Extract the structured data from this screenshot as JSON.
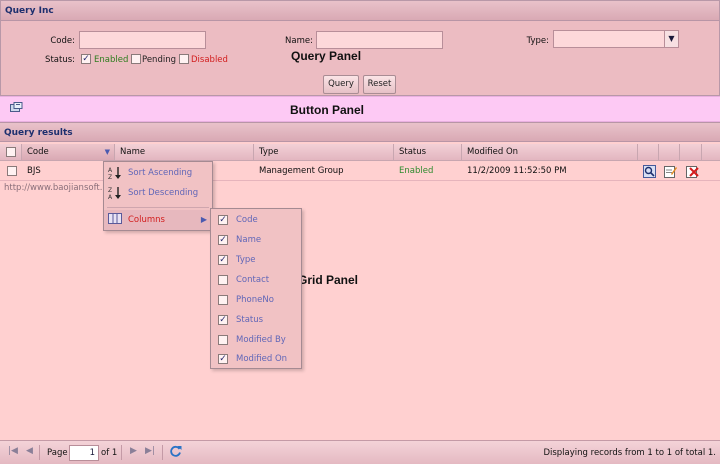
{
  "query_panel": {
    "title": "Query Inc",
    "code_label": "Code:",
    "code_value": "",
    "name_label": "Name:",
    "name_value": "",
    "type_label": "Type:",
    "type_value": "",
    "status_label": "Status:",
    "status_options": [
      {
        "label": "Enabled",
        "checked": true,
        "color": "#2e7d1e"
      },
      {
        "label": "Pending",
        "checked": false,
        "color": "#222222"
      },
      {
        "label": "Disabled",
        "checked": false,
        "color": "#d21e1e"
      }
    ],
    "query_button": "Query",
    "reset_button": "Reset",
    "annotation": "Query Panel"
  },
  "button_panel": {
    "annotation": "Button Panel"
  },
  "grid": {
    "title": "Query results",
    "columns": [
      "Code",
      "Name",
      "Type",
      "Status",
      "Modified On"
    ],
    "rows": [
      {
        "code": "BJS",
        "name": "",
        "type": "Management Group",
        "status": "Enabled",
        "modified_on": "11/2/2009 11:52:50 PM"
      }
    ],
    "watermark": "http://www.baojiansoft.c",
    "annotation": "Grid Panel",
    "status_color": "#2e8b2e"
  },
  "header_menu": {
    "items": [
      {
        "label": "Sort Ascending",
        "icon": "sort-ascending-icon"
      },
      {
        "label": "Sort Descending",
        "icon": "sort-descending-icon"
      },
      {
        "label": "Columns",
        "icon": "columns-icon"
      }
    ]
  },
  "columns_menu": {
    "items": [
      {
        "label": "Code",
        "checked": true
      },
      {
        "label": "Name",
        "checked": true
      },
      {
        "label": "Type",
        "checked": true
      },
      {
        "label": "Contact",
        "checked": false
      },
      {
        "label": "PhoneNo",
        "checked": false
      },
      {
        "label": "Status",
        "checked": true
      },
      {
        "label": "Modified By",
        "checked": false
      },
      {
        "label": "Modified On",
        "checked": true
      }
    ]
  },
  "paging": {
    "page_label": "Page",
    "page_value": "1",
    "of_label": "of 1",
    "display_text": "Displaying records from 1 to 1 of total 1."
  }
}
